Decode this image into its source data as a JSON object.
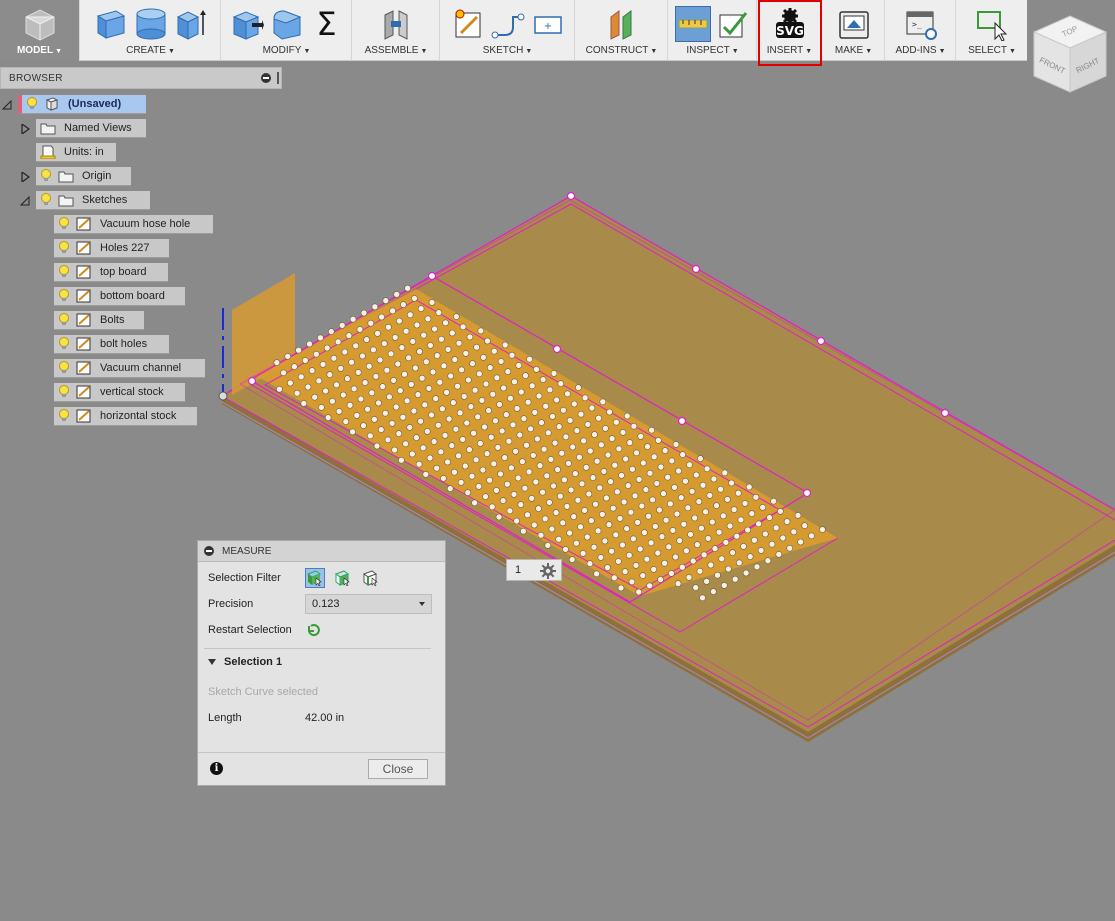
{
  "toolbar": {
    "groups": [
      {
        "label": "MODEL"
      },
      {
        "label": "CREATE"
      },
      {
        "label": "MODIFY"
      },
      {
        "label": "ASSEMBLE"
      },
      {
        "label": "SKETCH"
      },
      {
        "label": "CONSTRUCT"
      },
      {
        "label": "INSPECT"
      },
      {
        "label": "INSERT"
      },
      {
        "label": "MAKE"
      },
      {
        "label": "ADD-INS"
      },
      {
        "label": "SELECT"
      }
    ],
    "insert_icon_text": "SVG",
    "sigma_glyph": "Σ",
    "highlight_color": "#e00000"
  },
  "viewcube": {
    "top": "TOP",
    "front": "FRONT",
    "right": "RIGHT"
  },
  "browser": {
    "title": "BROWSER",
    "items": [
      {
        "label": "(Unsaved)"
      },
      {
        "label": "Named Views"
      },
      {
        "label": "Units: in"
      },
      {
        "label": "Origin"
      },
      {
        "label": "Sketches"
      },
      {
        "label": "Vacuum hose hole"
      },
      {
        "label": "Holes 227"
      },
      {
        "label": "top board"
      },
      {
        "label": "bottom board"
      },
      {
        "label": "Bolts"
      },
      {
        "label": "bolt holes"
      },
      {
        "label": "Vacuum channel"
      },
      {
        "label": "vertical stock"
      },
      {
        "label": "horizontal stock"
      }
    ]
  },
  "measure": {
    "title": "MEASURE",
    "selection_filter_label": "Selection Filter",
    "precision_label": "Precision",
    "precision_value": "0.123",
    "restart_label": "Restart Selection",
    "selection_header": "Selection 1",
    "selection_status": "Sketch Curve selected",
    "length_label": "Length",
    "length_value": "42.00 in",
    "close_label": "Close",
    "info_glyph": "i"
  },
  "canvas": {
    "widget_count": "1",
    "board_color": "#c8943a",
    "board_edge_color": "#e020c8",
    "hole_color": "#f4f0ea"
  }
}
